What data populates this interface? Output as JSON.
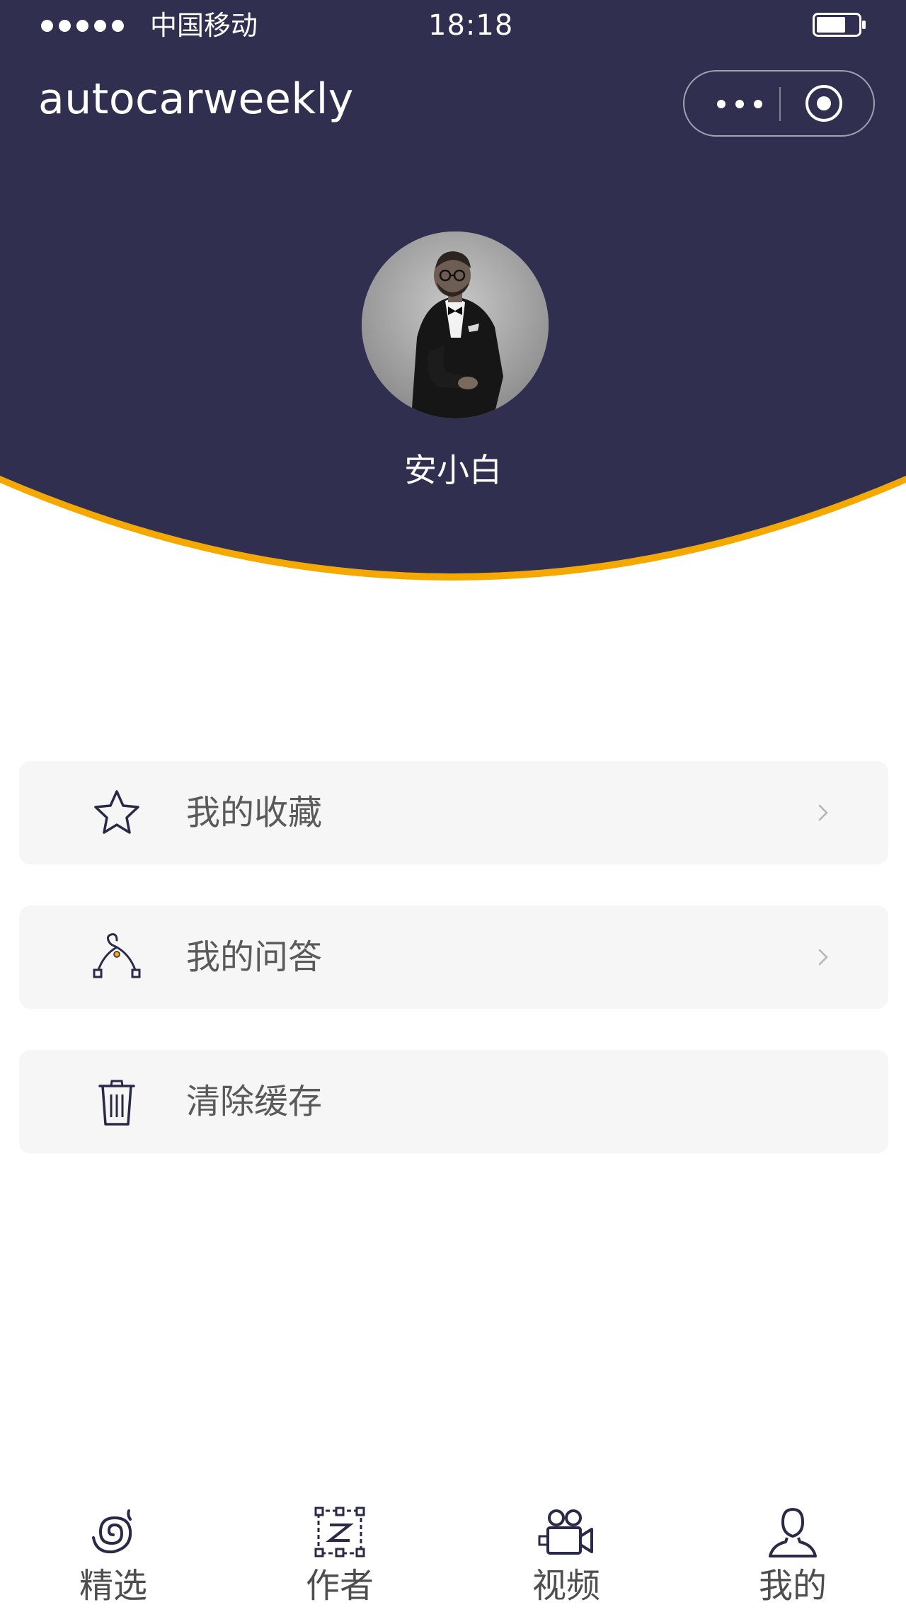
{
  "colors": {
    "header_bg": "#302f4f",
    "accent_curve": "#f5a800",
    "menu_bg": "#f6f6f6",
    "icon_dark": "#2a2a48",
    "text_gray": "#5a5a5a"
  },
  "status_bar": {
    "carrier": "中国移动",
    "time": "18:18",
    "signal_icon": "signal-dots-icon",
    "battery_icon": "battery-icon"
  },
  "nav": {
    "title": "autocarweekly",
    "more_icon": "more-dots-icon",
    "close_icon": "target-circle-icon"
  },
  "profile": {
    "name": "安小白",
    "avatar_icon": "avatar-photo"
  },
  "menu": {
    "items": [
      {
        "label": "我的收藏",
        "icon": "star-icon",
        "has_chevron": true
      },
      {
        "label": "我的问答",
        "icon": "hanger-qa-icon",
        "has_chevron": true
      },
      {
        "label": "清除缓存",
        "icon": "trash-icon",
        "has_chevron": false
      }
    ]
  },
  "tabbar": {
    "tabs": [
      {
        "label": "精选",
        "icon": "spiral-icon"
      },
      {
        "label": "作者",
        "icon": "frame-nodes-icon"
      },
      {
        "label": "视频",
        "icon": "video-camera-icon"
      },
      {
        "label": "我的",
        "icon": "user-icon"
      }
    ]
  }
}
